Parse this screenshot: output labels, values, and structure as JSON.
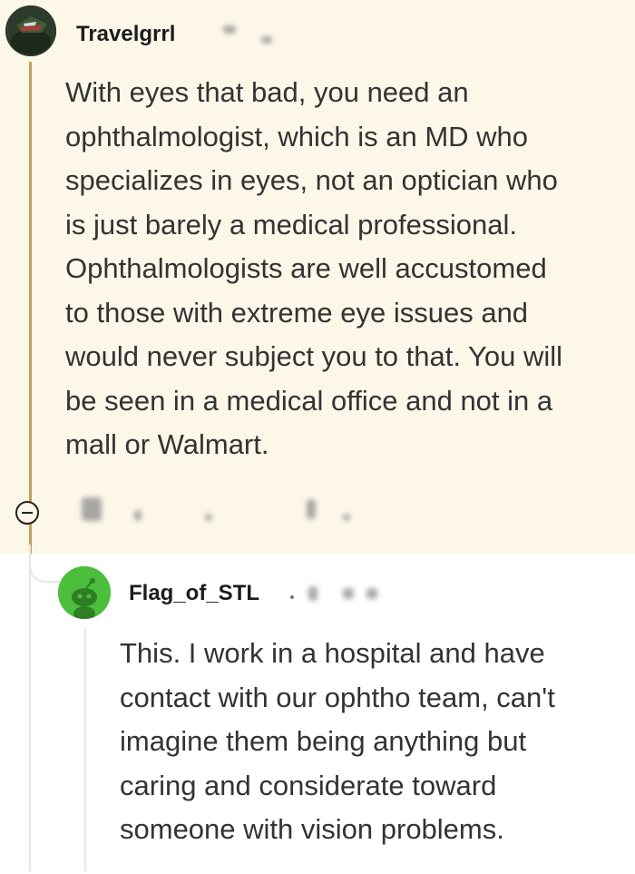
{
  "comments": [
    {
      "username": "Travelgrrl",
      "avatar_icon": "reddit-avatar-icon",
      "lines": [
        "With eyes that bad, you need an",
        "ophthalmologist, which is an MD who",
        "specializes in eyes, not an optician who",
        "is just barely a medical professional.",
        "Ophthalmologists are well accustomed",
        "to those with extreme eye issues and",
        "would never subject you to that. You will",
        "be seen in a medical office and not in a",
        "mall or Walmart."
      ],
      "highlight_color": "#fcf7e9",
      "thread_color": "#c2a356"
    },
    {
      "username": "Flag_of_STL",
      "separator": "•",
      "avatar_icon": "reddit-snoo-avatar-icon",
      "lines": [
        "This. I work in a hospital and have",
        "contact with our ophtho team, can't",
        "imagine them being anything but",
        "caring and considerate toward",
        "someone with vision problems."
      ],
      "avatar_color": "#4bbf3b"
    }
  ],
  "collapse_icon": "minus-circle-icon"
}
